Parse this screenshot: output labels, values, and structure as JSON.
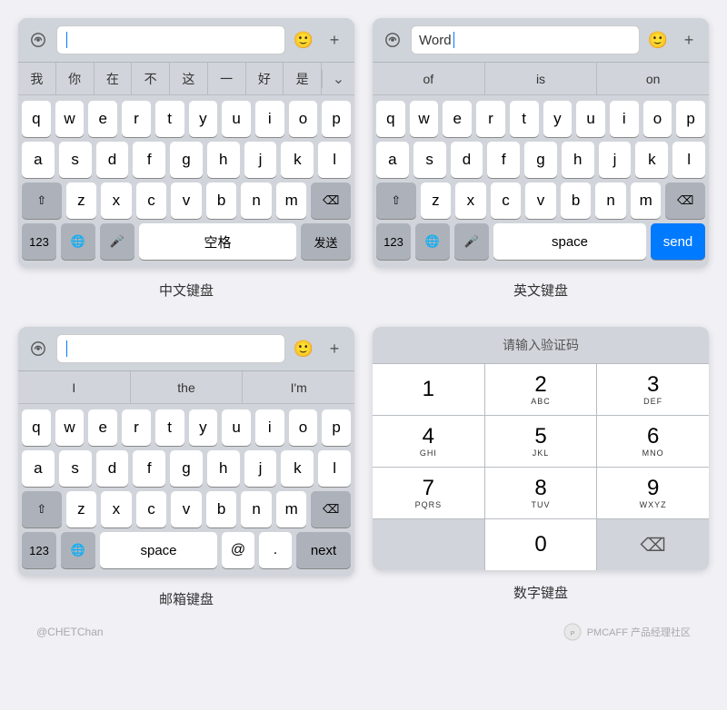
{
  "page": {
    "background": "#f0f0f5",
    "footer_left": "@CHETChan",
    "footer_right": "PMCAFF 产品经理社区"
  },
  "keyboards": {
    "chinese": {
      "label": "中文键盘",
      "input_placeholder": "",
      "suggestions": [
        "我",
        "你",
        "在",
        "不",
        "这",
        "一",
        "好",
        "是"
      ],
      "rows": [
        [
          "q",
          "w",
          "e",
          "r",
          "t",
          "y",
          "u",
          "i",
          "o",
          "p"
        ],
        [
          "a",
          "s",
          "d",
          "f",
          "g",
          "h",
          "j",
          "k",
          "l"
        ],
        [
          "z",
          "x",
          "c",
          "v",
          "b",
          "n",
          "m"
        ]
      ],
      "space_label": "空格",
      "send_label": "发送"
    },
    "english": {
      "label": "英文键盘",
      "input_value": "Word",
      "suggestions": [
        "of",
        "is",
        "on"
      ],
      "rows": [
        [
          "q",
          "w",
          "e",
          "r",
          "t",
          "y",
          "u",
          "i",
          "o",
          "p"
        ],
        [
          "a",
          "s",
          "d",
          "f",
          "g",
          "h",
          "j",
          "k",
          "l"
        ],
        [
          "z",
          "x",
          "c",
          "v",
          "b",
          "n",
          "m"
        ]
      ],
      "space_label": "space",
      "send_label": "send"
    },
    "email": {
      "label": "邮箱键盘",
      "input_placeholder": "",
      "suggestions": [
        "I",
        "the",
        "I'm"
      ],
      "rows": [
        [
          "q",
          "w",
          "e",
          "r",
          "t",
          "y",
          "u",
          "i",
          "o",
          "p"
        ],
        [
          "a",
          "s",
          "d",
          "f",
          "g",
          "h",
          "j",
          "k",
          "l"
        ],
        [
          "z",
          "x",
          "c",
          "v",
          "b",
          "n",
          "m"
        ]
      ],
      "space_label": "space",
      "at_label": "@",
      "dot_label": ".",
      "next_label": "next"
    },
    "numeric": {
      "label": "数字键盘",
      "header": "请输入验证码",
      "keys": [
        {
          "digit": "1",
          "letters": ""
        },
        {
          "digit": "2",
          "letters": "ABC"
        },
        {
          "digit": "3",
          "letters": "DEF"
        },
        {
          "digit": "4",
          "letters": "GHI"
        },
        {
          "digit": "5",
          "letters": "JKL"
        },
        {
          "digit": "6",
          "letters": "MNO"
        },
        {
          "digit": "7",
          "letters": "PQRS"
        },
        {
          "digit": "8",
          "letters": "TUV"
        },
        {
          "digit": "9",
          "letters": "WXYZ"
        },
        {
          "digit": "",
          "letters": ""
        },
        {
          "digit": "0",
          "letters": ""
        },
        {
          "digit": "⌫",
          "letters": ""
        }
      ]
    }
  }
}
